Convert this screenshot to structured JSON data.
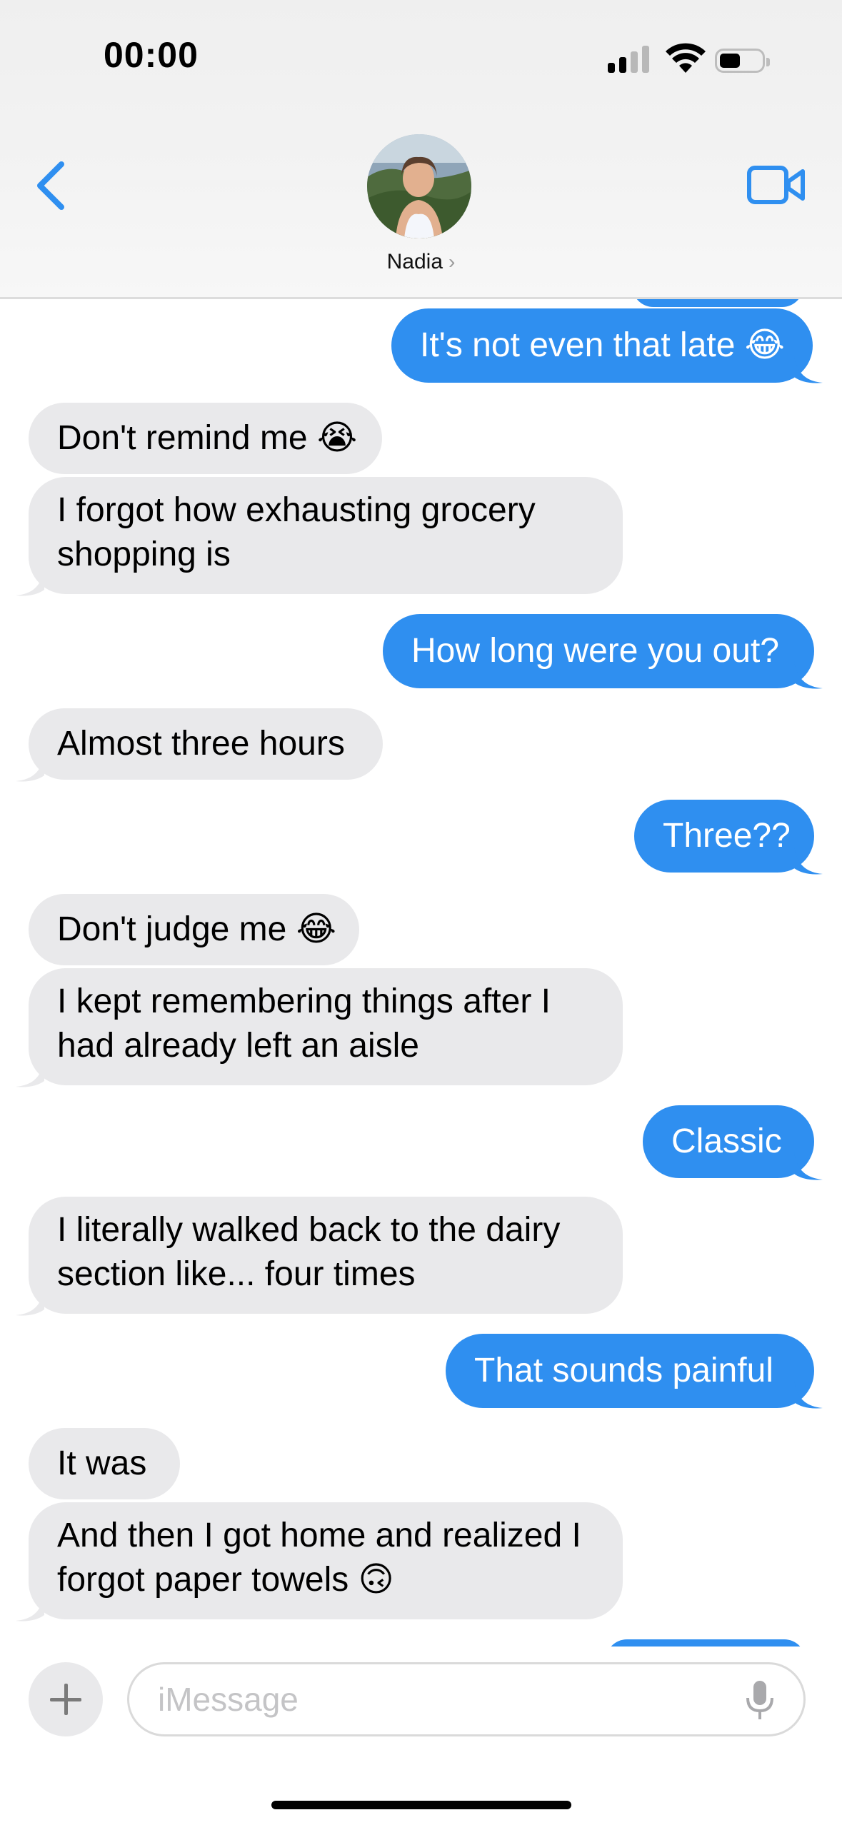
{
  "status_bar": {
    "time": "00:00",
    "battery_level": 0.45
  },
  "header": {
    "contact_name": "Nadia",
    "chevron": "›"
  },
  "icons": {
    "back": "chevron-left-icon",
    "video": "video-camera-icon",
    "plus": "plus-icon",
    "mic": "microphone-icon"
  },
  "colors": {
    "accent": "#2f8ff0",
    "received_bubble": "#e9e9eb",
    "sent_text": "#ffffff"
  },
  "messages": [
    {
      "dir": "sent",
      "text": "It's not even that late 😂"
    },
    {
      "dir": "received",
      "text": "Don't remind me 😭"
    },
    {
      "dir": "received",
      "text": "I forgot how exhausting grocery shopping is"
    },
    {
      "dir": "sent",
      "text": "How long were you out?"
    },
    {
      "dir": "received",
      "text": "Almost three hours"
    },
    {
      "dir": "sent",
      "text": "Three??"
    },
    {
      "dir": "received",
      "text": "Don't judge me 😂"
    },
    {
      "dir": "received",
      "text": "I kept remembering things after I had already left an aisle"
    },
    {
      "dir": "sent",
      "text": "Classic"
    },
    {
      "dir": "received",
      "text": "I literally walked back to the dairy section like... four times"
    },
    {
      "dir": "sent",
      "text": "That sounds painful"
    },
    {
      "dir": "received",
      "text": "It was"
    },
    {
      "dir": "received",
      "text": "And then I got home and realized I forgot paper towels 🙃"
    }
  ],
  "composer": {
    "placeholder": "iMessage"
  }
}
